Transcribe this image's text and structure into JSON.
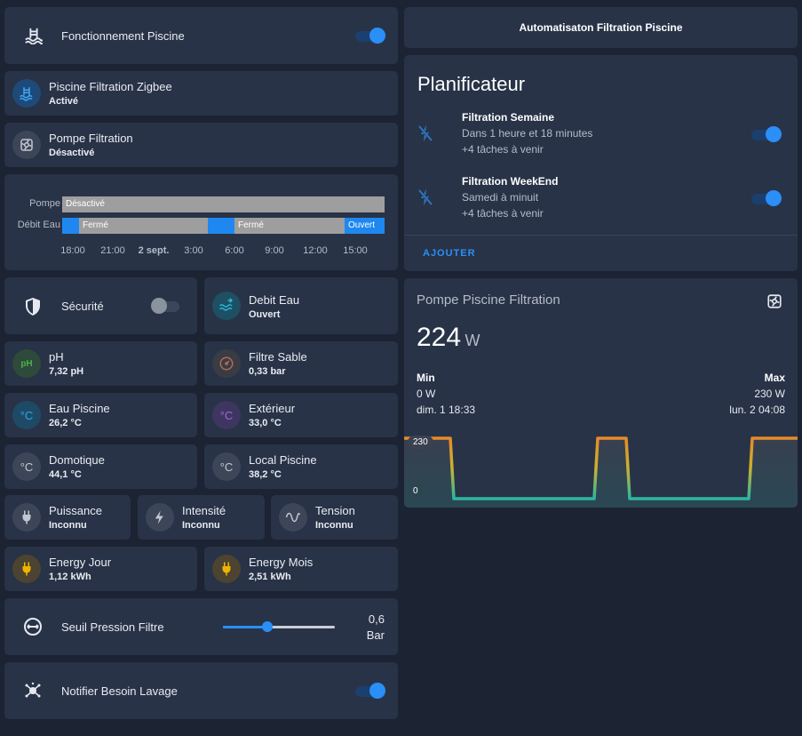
{
  "left": {
    "pool_operation": {
      "label": "Fonctionnement Piscine",
      "icon": "pool-icon",
      "on": true
    },
    "zigbee": {
      "name": "Piscine Filtration Zigbee",
      "state": "Activé",
      "icon": "pool-icon"
    },
    "pump": {
      "name": "Pompe Filtration",
      "state": "Désactivé",
      "icon": "pump-icon"
    },
    "timeline": {
      "rows": [
        {
          "label": "Pompe",
          "segments": [
            {
              "text": "Désactivé",
              "color": "#9e9e9e"
            }
          ]
        },
        {
          "label": "Débit Eau",
          "segments": [
            {
              "text": "",
              "color": "#1e88f0"
            },
            {
              "text": "Fermé",
              "color": "#9e9e9e"
            },
            {
              "text": "",
              "color": "#1e88f0"
            },
            {
              "text": "Fermé",
              "color": "#9e9e9e"
            },
            {
              "text": "Ouvert",
              "color": "#1e88f0"
            }
          ]
        }
      ],
      "ticks": [
        "18:00",
        "21:00",
        "2 sept.",
        "3:00",
        "6:00",
        "9:00",
        "12:00",
        "15:00"
      ]
    },
    "security": {
      "label": "Sécurité",
      "icon": "shield-icon",
      "on": false
    },
    "flow": {
      "name": "Debit Eau",
      "state": "Ouvert",
      "icon": "water-flow-icon"
    },
    "sensors": [
      {
        "name": "pH",
        "state": "7,32 pH",
        "icon": "ph-icon",
        "color": "#4caf50"
      },
      {
        "name": "Filtre Sable",
        "state": "0,33 bar",
        "icon": "gauge-icon",
        "color": "#8a8f99"
      },
      {
        "name": "Eau Piscine",
        "state": "26,2 °C",
        "icon": "celsius-icon",
        "color": "#29a9e8"
      },
      {
        "name": "Extérieur",
        "state": "33,0 °C",
        "icon": "celsius-icon",
        "color": "#9b6ad6"
      },
      {
        "name": "Domotique",
        "state": "44,1 °C",
        "icon": "celsius-icon",
        "color": "#8a8f99"
      },
      {
        "name": "Local Piscine",
        "state": "38,2 °C",
        "icon": "celsius-icon",
        "color": "#8a8f99"
      }
    ],
    "electric": [
      {
        "name": "Puissance",
        "state": "Inconnu",
        "icon": "plug-icon"
      },
      {
        "name": "Intensité",
        "state": "Inconnu",
        "icon": "lightning-icon"
      },
      {
        "name": "Tension",
        "state": "Inconnu",
        "icon": "sine-wave-icon"
      }
    ],
    "energy": [
      {
        "name": "Energy Jour",
        "state": "1,12 kWh",
        "icon": "plug-icon",
        "color": "#f0b400"
      },
      {
        "name": "Energy Mois",
        "state": "2,51 kWh",
        "icon": "plug-icon",
        "color": "#f0b400"
      }
    ],
    "threshold": {
      "label": "Seuil Pression Filtre",
      "value": "0,6",
      "unit": "Bar",
      "level": 0.4,
      "icon": "pressure-icon"
    },
    "wash": {
      "label": "Notifier Besoin Lavage",
      "icon": "splash-icon",
      "on": true
    }
  },
  "right": {
    "automation_title": "Automatisaton Filtration Piscine",
    "scheduler": {
      "title": "Planificateur",
      "items": [
        {
          "title": "Filtration Semaine",
          "line1": "Dans 1 heure et 18 minutes",
          "line2": "+4 tâches à venir",
          "on": true,
          "icon": "flash-off-icon"
        },
        {
          "title": "Filtration WeekEnd",
          "line1": "Samedi à minuit",
          "line2": "+4 tâches à venir",
          "on": true,
          "icon": "flash-off-icon"
        }
      ],
      "add_label": "AJOUTER"
    },
    "power": {
      "title": "Pompe Piscine Filtration",
      "value": "224",
      "unit": "W",
      "min_label": "Min",
      "min_value": "0 W",
      "min_time": "dim. 1 18:33",
      "max_label": "Max",
      "max_value": "230 W",
      "max_time": "lun. 2 04:08",
      "graph_max_label": "230",
      "graph_min_label": "0",
      "icon": "pump-icon"
    }
  }
}
